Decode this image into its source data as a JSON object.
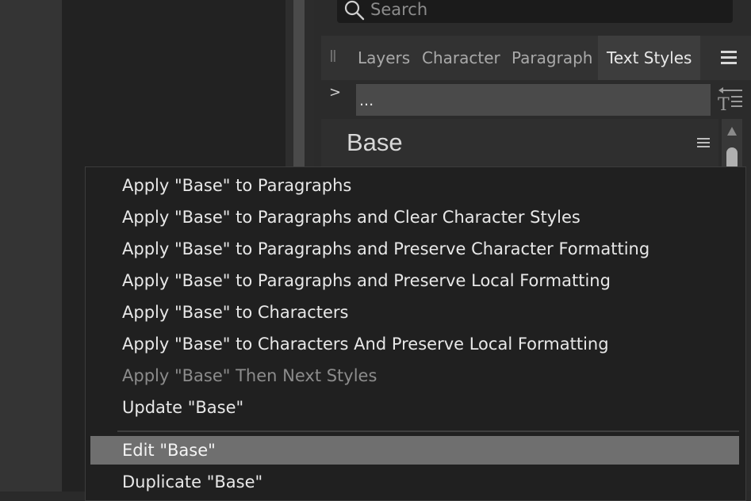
{
  "search": {
    "placeholder": "Search",
    "icon": "search-icon"
  },
  "tabs": [
    {
      "label": "Layers",
      "active": false
    },
    {
      "label": "Character",
      "active": false
    },
    {
      "label": "Paragraph",
      "active": false
    },
    {
      "label": "Text Styles",
      "active": true
    }
  ],
  "path": {
    "value": "..."
  },
  "style": {
    "name": "Base"
  },
  "context_menu": {
    "items": [
      {
        "label": "Apply \"Base\" to Paragraphs",
        "state": "normal"
      },
      {
        "label": "Apply \"Base\" to Paragraphs and Clear Character Styles",
        "state": "normal"
      },
      {
        "label": "Apply \"Base\" to Paragraphs and Preserve Character Formatting",
        "state": "normal"
      },
      {
        "label": "Apply \"Base\" to Paragraphs and Preserve Local Formatting",
        "state": "normal"
      },
      {
        "label": "Apply \"Base\" to Characters",
        "state": "normal"
      },
      {
        "label": "Apply \"Base\" to Characters And Preserve Local Formatting",
        "state": "normal"
      },
      {
        "label": "Apply \"Base\" Then Next Styles",
        "state": "disabled"
      },
      {
        "label": "Update \"Base\"",
        "state": "normal"
      },
      {
        "label": "Edit \"Base\"",
        "state": "highlighted"
      },
      {
        "label": "Duplicate \"Base\"",
        "state": "normal"
      }
    ]
  },
  "colors": {
    "panel_bg": "#2b2b2b",
    "menu_bg": "#202020",
    "menu_highlight": "#6f6f6f",
    "disabled_text": "#8c8c8c"
  }
}
